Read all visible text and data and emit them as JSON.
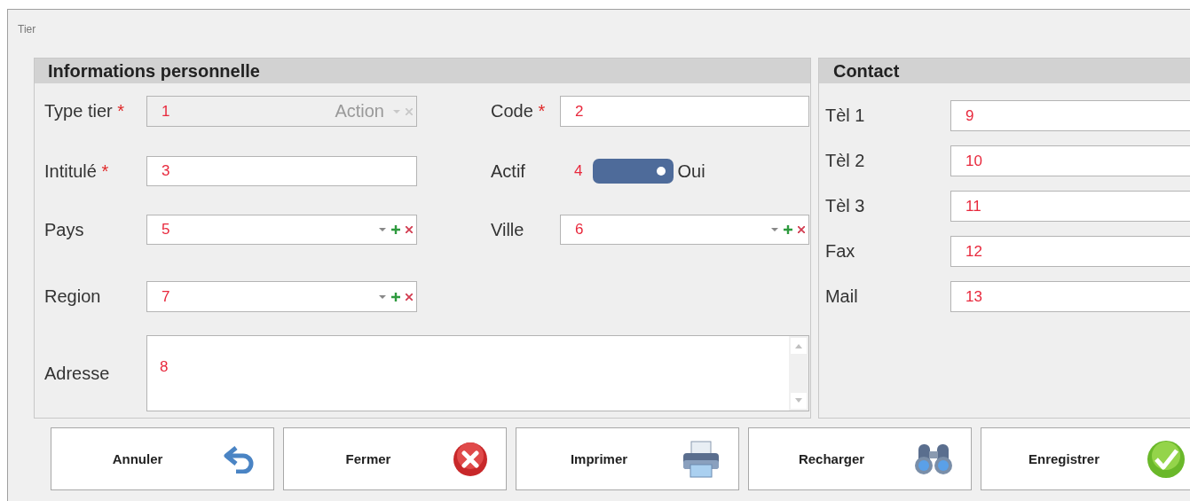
{
  "window": {
    "title": "Tier"
  },
  "personal": {
    "title": "Informations personnelle",
    "rows": [
      [
        {
          "kind": "combo",
          "label": "Type tier",
          "required_mark": "*",
          "value": "1",
          "hint": "Action",
          "disabled": true,
          "addable": false
        },
        {
          "kind": "text",
          "label": "Code",
          "required_mark": "*",
          "value": "2"
        }
      ],
      [
        {
          "kind": "text",
          "label": "Intitulé",
          "required_mark": "*",
          "value": "3"
        },
        {
          "kind": "toggle",
          "label": "Actif",
          "value": "4",
          "on": true,
          "caption": "Oui"
        }
      ],
      [
        {
          "kind": "combo",
          "label": "Pays",
          "value": "5",
          "disabled": false,
          "addable": true
        },
        {
          "kind": "combo",
          "label": "Ville",
          "value": "6",
          "disabled": false,
          "addable": true
        }
      ],
      [
        {
          "kind": "combo",
          "label": "Region",
          "value": "7",
          "disabled": false,
          "addable": true
        }
      ],
      [
        {
          "kind": "textarea",
          "label": "Adresse",
          "value": "8"
        }
      ]
    ]
  },
  "contact": {
    "title": "Contact",
    "fields": [
      {
        "label": "Tèl 1",
        "value": "9"
      },
      {
        "label": "Tèl 2",
        "value": "10"
      },
      {
        "label": "Tèl 3",
        "value": "11"
      },
      {
        "label": "Fax",
        "value": "12"
      },
      {
        "label": "Mail",
        "value": "13"
      }
    ]
  },
  "buttons": [
    {
      "label": "Annuler",
      "kind": "cancel"
    },
    {
      "label": "Fermer",
      "kind": "close"
    },
    {
      "label": "Imprimer",
      "kind": "print"
    },
    {
      "label": "Recharger",
      "kind": "reload"
    },
    {
      "label": "Enregistrer",
      "kind": "save"
    }
  ]
}
